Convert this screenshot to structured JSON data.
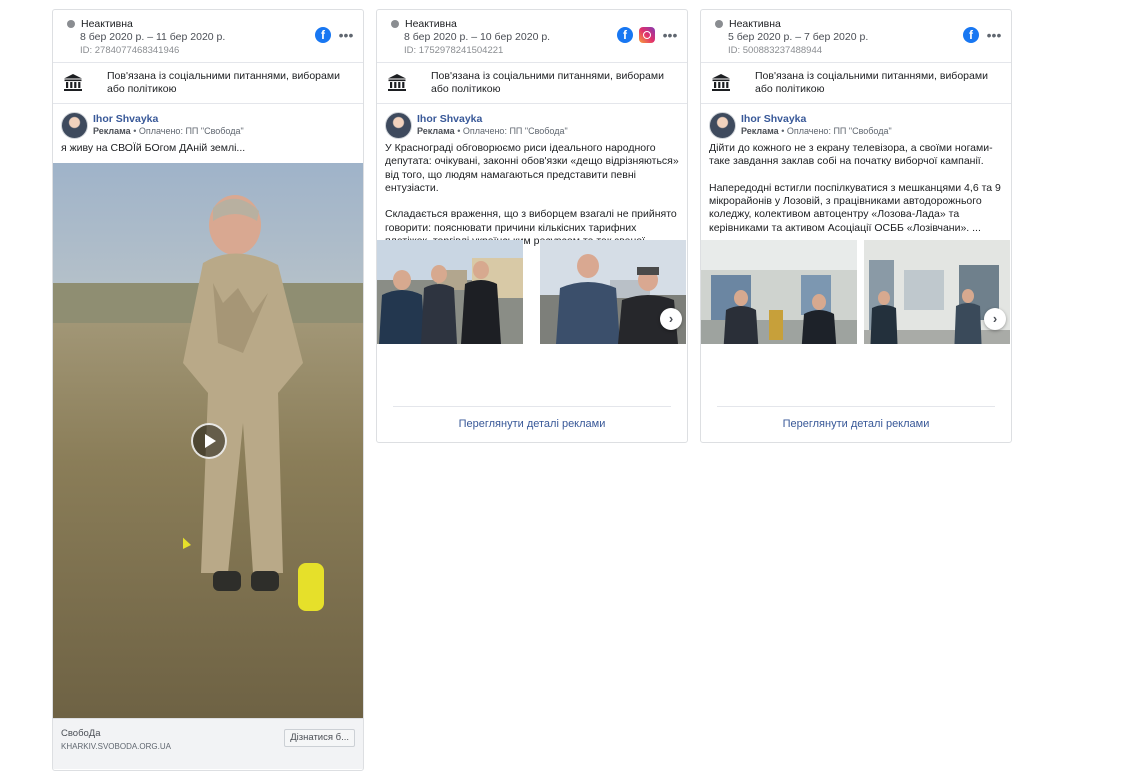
{
  "cards": [
    {
      "status": "Неактивна",
      "dates": "8 бер 2020 р. – 11 бер 2020 р.",
      "id": "ID: 2784077468341946",
      "political": "Пов'язана із соціальними питаннями, виборами або політикою",
      "author": "Ihor Shvayka",
      "ad_label": "Реклама",
      "paid_by": "• Оплачено: ПП \"Свобода\"",
      "text": "я живу на СВОЇй БОгом ДАній землі...",
      "cta_title": "СвобоДа",
      "cta_url": "KHARKIV.SVOBODA.ORG.UA",
      "cta_button": "Дізнатися б..."
    },
    {
      "status": "Неактивна",
      "dates": "8 бер 2020 р. – 10 бер 2020 р.",
      "id": "ID: 1752978241504221",
      "political": "Пов'язана із соціальними питаннями, виборами або політикою",
      "author": "Ihor Shvayka",
      "ad_label": "Реклама",
      "paid_by": "• Оплачено: ПП \"Свобода\"",
      "text": "У Краснограді обговорюємо риси ідеального народного депутата: очікувані, законні обов'язки «дещо відрізняються» від того, що людям намагаються представити певні ентузіасти.\n\nСкладається враження, що з виборцем взагалі не прийнято говорити: пояснювати причини кількісних тарифних платіжок, торгівлі українським ресурсом та так званої оптимізації. ...",
      "details": "Переглянути деталі реклами"
    },
    {
      "status": "Неактивна",
      "dates": "5 бер 2020 р. – 7 бер 2020 р.",
      "id": "ID: 500883237488944",
      "political": "Пов'язана із соціальними питаннями, виборами або політикою",
      "author": "Ihor Shvayka",
      "ad_label": "Реклама",
      "paid_by": "• Оплачено: ПП \"Свобода\"",
      "text": "Дійти до кожного не з екрану телевізора, а своїми ногами-таке завдання заклав собі на початку виборчої кампанії.\n\nНапередодні встигли поспілкуватися з мешканцями 4,6 та 9 мікрорайонів у Лозовій, з працівниками автодорожнього коледжу, колективом автоцентру «Лозова-Лада» та керівниками та активом Асоціації ОСББ «Лозівчани». ...",
      "details": "Переглянути деталі реклами"
    }
  ],
  "colors": {
    "link": "#385898",
    "facebook": "#1877f2",
    "muted": "#8a8d91"
  },
  "icons": [
    "facebook-icon",
    "instagram-icon",
    "more-icon",
    "government-building-icon",
    "play-icon",
    "chevron-right-icon"
  ]
}
